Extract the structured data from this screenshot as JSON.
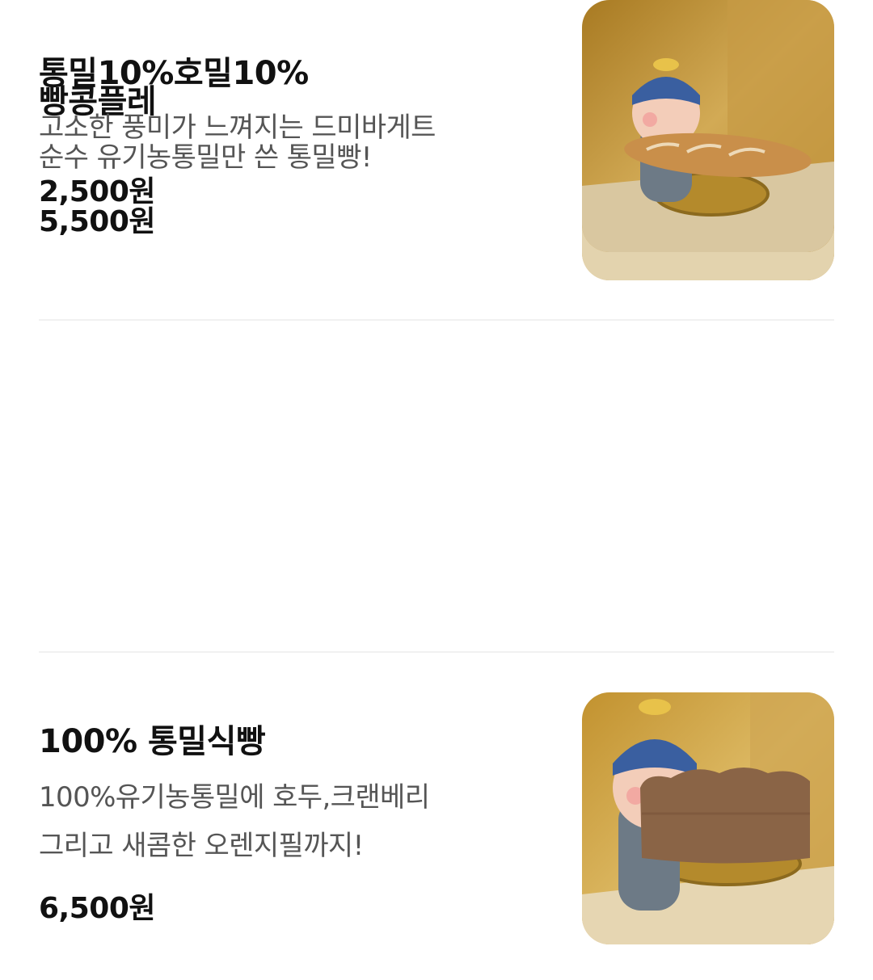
{
  "menu": {
    "items": [
      {
        "name": "빵콩플레",
        "description": [
          "순수 유기농통밀만 쓴 통밀빵!"
        ],
        "price": "5,500원",
        "image": "photo of figurine holding a scored whole-wheat loaf"
      },
      {
        "name": "100% 통밀식빵",
        "description": [
          "100%유기농통밀에 호두,크랜베리",
          "그리고 새콤한 오렌지필까지!"
        ],
        "price": "6,500원",
        "image": "photo of figurine holding a whole-wheat pan loaf"
      },
      {
        "name": "통밀10%호밀10%",
        "description": [
          "고소한 풍미가 느껴지는 드미바게트"
        ],
        "price": "2,500원",
        "image": "photo of figurine holding a demi baguette"
      }
    ]
  },
  "colors": {
    "text_primary": "#111111",
    "text_secondary": "#555555",
    "divider": "#f1f1f1",
    "background": "#ffffff"
  }
}
